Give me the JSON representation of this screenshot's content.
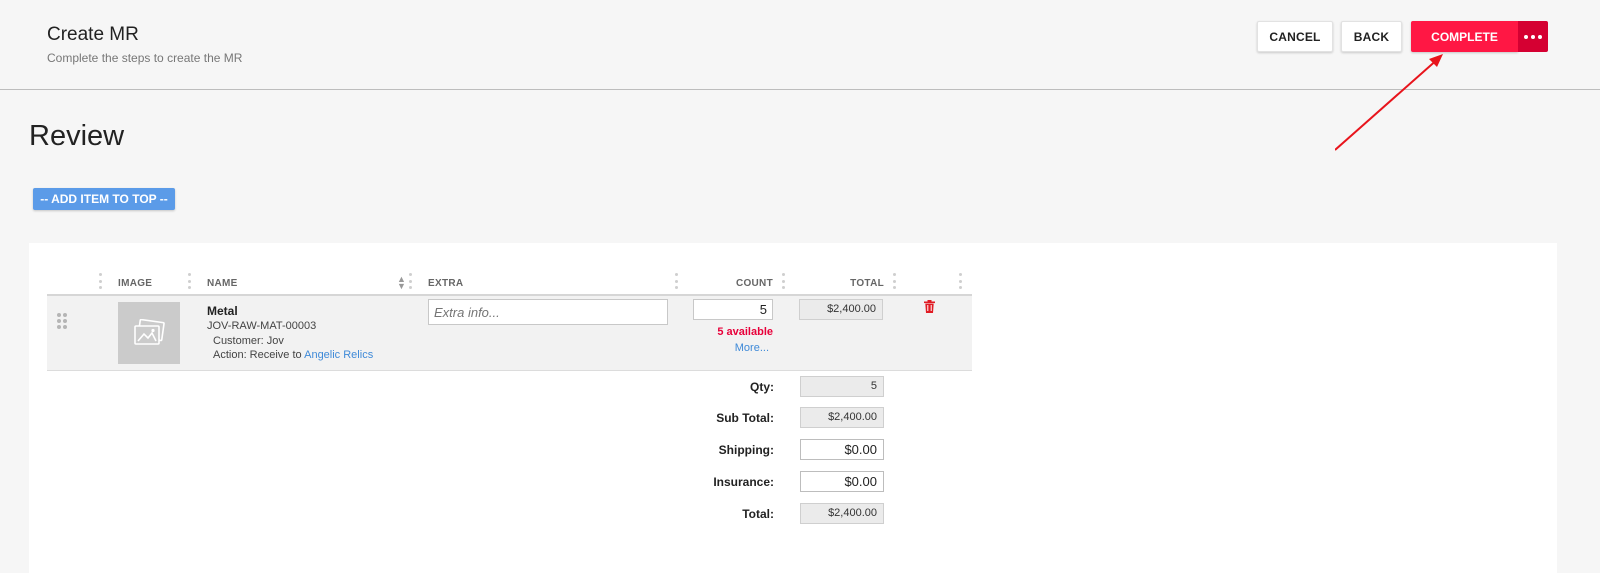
{
  "header": {
    "title": "Create MR",
    "subtitle": "Complete the steps to create the MR",
    "cancel_label": "CANCEL",
    "back_label": "BACK",
    "complete_label": "COMPLETE",
    "complete_color": "#ff1744"
  },
  "review": {
    "heading": "Review",
    "add_item_label": "-- ADD ITEM TO TOP --"
  },
  "table": {
    "columns": [
      "IMAGE",
      "NAME",
      "EXTRA",
      "COUNT",
      "TOTAL"
    ],
    "rows": [
      {
        "name": "Metal",
        "sku": "JOV-RAW-MAT-00003",
        "customer": "Customer: Jov",
        "action_prefix": "Action: Receive to",
        "action_link": "Angelic Relics",
        "extra_placeholder": "Extra info...",
        "count": "5",
        "available": "5 available",
        "more": "More...",
        "total": "$2,400.00"
      }
    ]
  },
  "summary": {
    "qty_label": "Qty:",
    "qty_value": "5",
    "subtotal_label": "Sub Total:",
    "subtotal_value": "$2,400.00",
    "shipping_label": "Shipping:",
    "shipping_value": "$0.00",
    "insurance_label": "Insurance:",
    "insurance_value": "$0.00",
    "total_label": "Total:",
    "total_value": "$2,400.00"
  }
}
